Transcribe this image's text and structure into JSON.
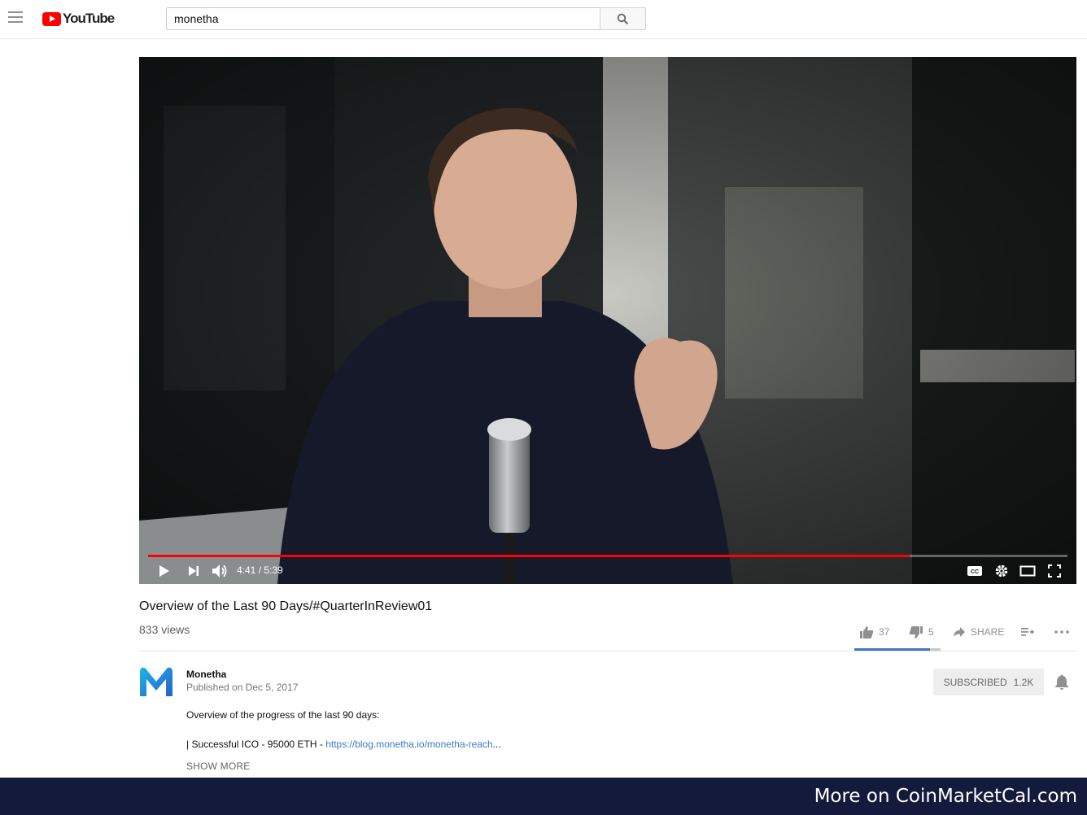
{
  "app": {
    "logo_text": "YouTube",
    "brand_color": "#ff0000"
  },
  "search": {
    "value": "monetha"
  },
  "player": {
    "time_display": "4:41 / 5:39",
    "progress_fraction": 0.828,
    "icons": {
      "play": "play-icon",
      "next": "next-icon",
      "volume": "volume-icon",
      "captions": "captions-icon",
      "settings": "gear-icon",
      "theater": "theater-mode-icon",
      "fullscreen": "fullscreen-icon"
    }
  },
  "video": {
    "title": "Overview of the Last 90 Days/#QuarterInReview01",
    "views": "833 views",
    "likes": "37",
    "dislikes": "5",
    "like_fraction": 0.881,
    "share_label": "SHARE"
  },
  "channel": {
    "name": "Monetha",
    "published": "Published on Dec 5, 2017",
    "subscribe_label": "SUBSCRIBED",
    "subscriber_count": "1.2K"
  },
  "description": {
    "line1": "Overview of the progress of the last 90 days:",
    "line2_prefix": "| Successful ICO - 95000 ETH - ",
    "line2_link": "https://blog.monetha.io/monetha-reach",
    "line2_suffix": "...",
    "show_more": "SHOW MORE"
  },
  "banner": {
    "text": "More on CoinMarketCal.com"
  }
}
